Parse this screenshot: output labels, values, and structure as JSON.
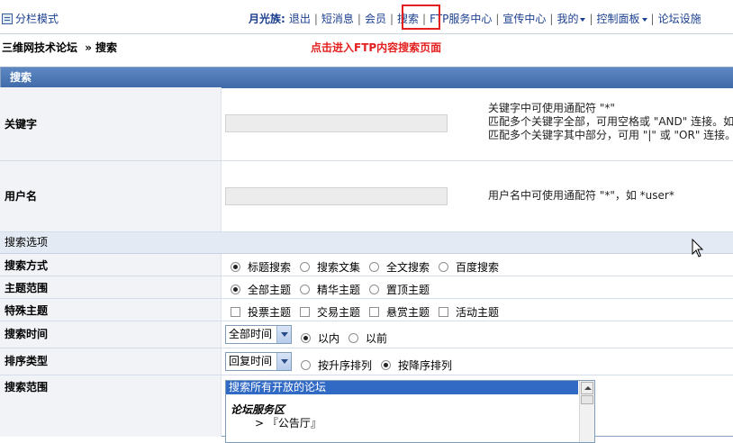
{
  "topbar": {
    "layout_toggle": "分栏模式",
    "user": "月光族:",
    "links": [
      "退出",
      "短消息",
      "会员",
      "搜索",
      "FTP服务中心",
      "宣传中心",
      "我的",
      "控制面板",
      "论坛设施"
    ]
  },
  "breadcrumb": {
    "site": "三维网技术论坛",
    "arrow": "»",
    "page": "搜索"
  },
  "annotation": "点击进入FTP内容搜索页面",
  "panel": {
    "title": "搜索"
  },
  "keyword": {
    "label": "关键字",
    "value": "",
    "hints": [
      "关键字中可使用通配符 \"*\"",
      "匹配多个关键字全部，可用空格或 \"AND\" 连接。如",
      "匹配多个关键字其中部分，可用 \"|\" 或 \"OR\" 连接。"
    ]
  },
  "username": {
    "label": "用户名",
    "value": "",
    "hint": "用户名中可使用通配符 \"*\"，如 *user*"
  },
  "options_section": "搜索选项",
  "search_method": {
    "label": "搜索方式",
    "options": [
      "标题搜索",
      "搜索文集",
      "全文搜索",
      "百度搜索"
    ],
    "selected": "标题搜索"
  },
  "topic_range": {
    "label": "主题范围",
    "options": [
      "全部主题",
      "精华主题",
      "置顶主题"
    ],
    "selected": "全部主题"
  },
  "special_topics": {
    "label": "特殊主题",
    "options": [
      "投票主题",
      "交易主题",
      "悬赏主题",
      "活动主题"
    ]
  },
  "search_time": {
    "label": "搜索时间",
    "select_value": "全部时间",
    "options": [
      "以内",
      "以前"
    ],
    "selected": "以内"
  },
  "sort_type": {
    "label": "排序类型",
    "select_value": "回复时间",
    "options": [
      "按升序排列",
      "按降序排列"
    ],
    "selected": "按降序排列"
  },
  "search_scope": {
    "label": "搜索范围",
    "selected_item": "搜索所有开放的论坛",
    "group": "论坛服务区",
    "items": [
      "> 『公告厅』"
    ]
  },
  "colors": {
    "link": "#1b3f8f",
    "header": "#4a76b5",
    "annotation": "#e3201f",
    "highlight_box": "#e3201f"
  }
}
